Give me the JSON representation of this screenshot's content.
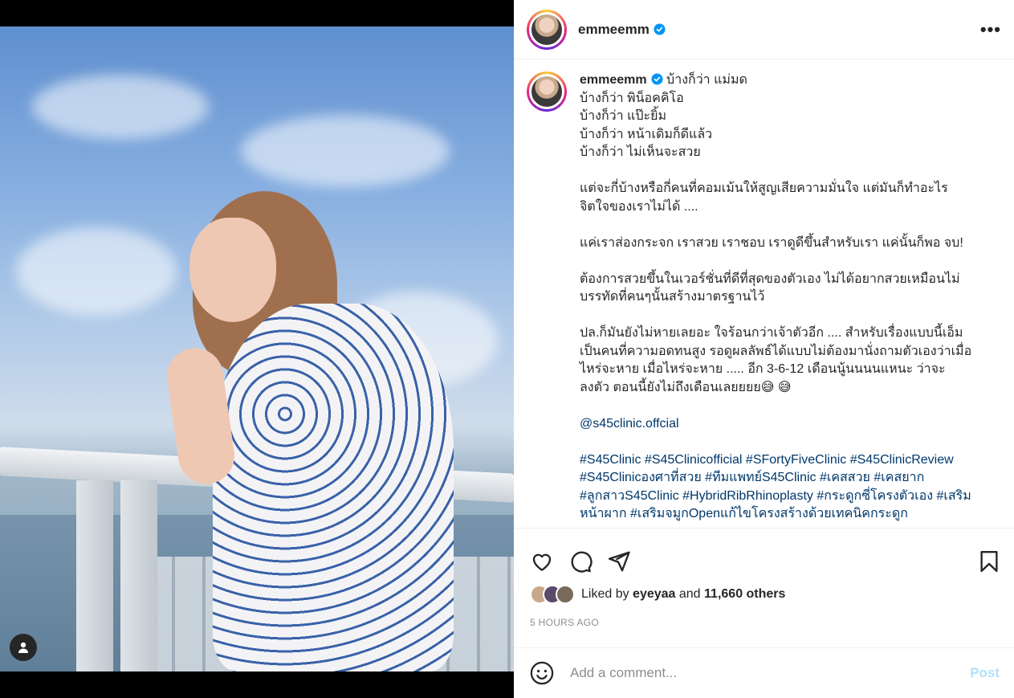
{
  "author": {
    "username": "emmeemm",
    "verified": true
  },
  "header": {
    "more_label": "•••"
  },
  "caption": {
    "username": "emmeemm",
    "text": " บ้างก็ว่า แม่มด\nบ้างก็ว่า พิน็อคคิโอ\nบ้างก็ว่า แป๊ะยิ้ม\nบ้างก็ว่า หน้าเดิมก็ดีแล้ว\nบ้างก็ว่า ไม่เห็นจะสวย\n\nแต่จะกี่บ้างหรือกี่คนที่คอมเม้นให้สูญเสียความมั่นใจ แต่มันก็ทำอะไรจิตใจของเราไม่ได้ ....\n\nแค่เราส่องกระจก เราสวย เราชอบ เราดูดีขึ้นสำหรับเรา แค่นั้นก็พอ จบ!\n\nต้องการสวยขึ้นในเวอร์ชั่นที่ดีที่สุดของตัวเอง ไม่ได้อยากสวยเหมือนไม่บรรทัดที่คนๆนั้นสร้างมาตรฐานไว้\n\nปล.ก็มันยังไม่หายเลยอะ ใจร้อนกว่าเจ้าตัวอีก .... สำหรับเรื่องแบบนี้เอ็มเป็นคนที่ความอดทนสูง รอดูผลลัพธ์ได้แบบไม่ต้องมานั่งถามตัวเองว่าเมื่อไหร่จะหาย เมื่อไหร่จะหาย ..... อีก 3-6-12 เดือนนู้นนนนแหนะ ว่าจะลงตัว ตอนนี้ยังไม่ถึงเดือนเลยยยย😅 😅\n\n",
    "mention": "@s45clinic.offcial",
    "tags": "#S45Clinic #S45Clinicofficial #SFortyFiveClinic #S45ClinicReview #S45Clinicองศาที่สวย #ทีมแพทย์S45Clinic #เคสสวย #เคสยาก #ลูกสาวS45Clinic #HybridRibRhinoplasty #กระดูกซี่โครงตัวเอง #เสริมหน้าผาก #เสริมจมูกOpenแก้ไขโครงสร้างด้วยเทคนิคกระดูก"
  },
  "likes": {
    "prefix": "Liked by ",
    "user": "eyeyaa",
    "middle": " and ",
    "others": "11,660 others"
  },
  "timestamp": "5 HOURS AGO",
  "comment": {
    "placeholder": "Add a comment...",
    "post_label": "Post"
  },
  "colors": {
    "link": "#00376b",
    "verified": "#0095f6",
    "post_disabled": "#b2dffc"
  },
  "icons": [
    "heart-icon",
    "comment-icon",
    "share-icon",
    "bookmark-icon",
    "emoji-icon",
    "user-tag-icon",
    "verified-badge-icon",
    "more-options-icon"
  ]
}
